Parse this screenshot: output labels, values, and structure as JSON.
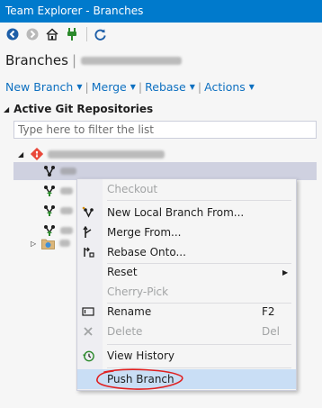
{
  "window": {
    "title": "Team Explorer - Branches"
  },
  "toolbar": {
    "icons": [
      "back-icon",
      "forward-icon",
      "home-icon",
      "connect-icon",
      "refresh-icon"
    ]
  },
  "page": {
    "title": "Branches",
    "separator": "|"
  },
  "actions": {
    "new_branch": "New Branch",
    "merge": "Merge",
    "rebase": "Rebase",
    "actions": "Actions",
    "separator": "|"
  },
  "section": {
    "title": "Active Git Repositories"
  },
  "filter": {
    "placeholder": "Type here to filter the list",
    "value": ""
  },
  "context_menu": {
    "items": [
      {
        "label": "Checkout",
        "disabled": true,
        "icon": ""
      },
      {
        "label": "New Local Branch From...",
        "icon": "new-branch-icon"
      },
      {
        "label": "Merge From...",
        "icon": "merge-icon"
      },
      {
        "label": "Rebase Onto...",
        "icon": "rebase-icon"
      },
      {
        "label": "Reset",
        "has_submenu": true
      },
      {
        "label": "Cherry-Pick",
        "disabled": true
      },
      {
        "label": "Rename",
        "shortcut": "F2",
        "icon": "rename-icon"
      },
      {
        "label": "Delete",
        "shortcut": "Del",
        "disabled": true,
        "icon": "delete-icon"
      },
      {
        "label": "View History",
        "icon": "history-icon"
      },
      {
        "label": "Push Branch",
        "highlighted": true
      }
    ]
  },
  "colors": {
    "titlebar": "#007acc",
    "link": "#0e70c0",
    "selection": "#cfd1e0",
    "menu_highlight": "#c9def5",
    "annotation_circle": "#e02020"
  }
}
